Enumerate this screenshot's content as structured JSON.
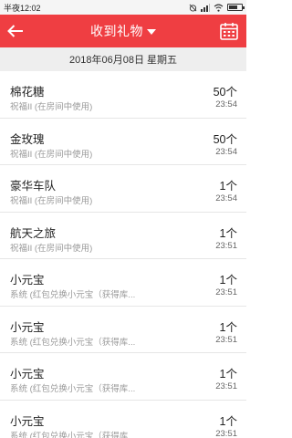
{
  "status_bar": {
    "time": "半夜12:02"
  },
  "header": {
    "title": "收到礼物",
    "back_icon": "arrow-left-icon",
    "dropdown_icon": "caret-down-icon",
    "calendar_icon": "calendar-icon",
    "accent_color": "#ef3e42"
  },
  "date": "2018年06月08日 星期五",
  "gifts": [
    {
      "name": "棉花糖",
      "source": "祝福II (在房间中使用)",
      "qty": "50个",
      "time": "23:54"
    },
    {
      "name": "金玫瑰",
      "source": "祝福II (在房间中使用)",
      "qty": "50个",
      "time": "23:54"
    },
    {
      "name": "豪华车队",
      "source": "祝福II (在房间中使用)",
      "qty": "1个",
      "time": "23:54"
    },
    {
      "name": "航天之旅",
      "source": "祝福II (在房间中使用)",
      "qty": "1个",
      "time": "23:51"
    },
    {
      "name": "小元宝",
      "source": "系统 (红包兑换小元宝（获得库...",
      "qty": "1个",
      "time": "23:51"
    },
    {
      "name": "小元宝",
      "source": "系统 (红包兑换小元宝（获得库...",
      "qty": "1个",
      "time": "23:51"
    },
    {
      "name": "小元宝",
      "source": "系统 (红包兑换小元宝（获得库...",
      "qty": "1个",
      "time": "23:51"
    },
    {
      "name": "小元宝",
      "source": "系统 (红包兑换小元宝（获得库...",
      "qty": "1个",
      "time": "23:51"
    }
  ]
}
